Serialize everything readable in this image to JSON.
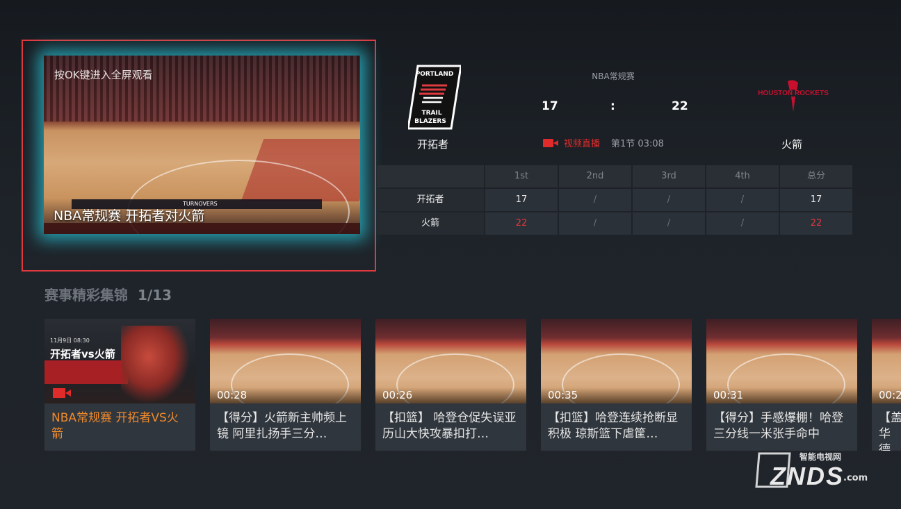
{
  "player": {
    "hint": "按OK键进入全屏观看",
    "title": "NBA常规赛 开拓者对火箭",
    "scorebug": "TURNOVERS"
  },
  "match": {
    "league": "NBA常规赛",
    "home": {
      "name": "开拓者",
      "score": "17",
      "logo": "portland-trail-blazers-logo"
    },
    "away": {
      "name": "火箭",
      "score": "22",
      "logo": "houston-rockets-logo"
    },
    "separator": ":",
    "live_label": "视频直播",
    "period": "第1节 03:08"
  },
  "score_table": {
    "headers": [
      "",
      "1st",
      "2nd",
      "3rd",
      "4th",
      "总分"
    ],
    "rows": [
      {
        "team": "开拓者",
        "q1": "17",
        "q2": "/",
        "q3": "/",
        "q4": "/",
        "total": "17"
      },
      {
        "team": "火箭",
        "q1": "22",
        "q2": "/",
        "q3": "/",
        "q4": "/",
        "total": "22"
      }
    ]
  },
  "highlights": {
    "title": "赛事精彩集锦",
    "count": "1/13",
    "items": [
      {
        "title": "NBA常规赛 开拓者VS火箭",
        "duration": "",
        "poster_text": "开拓者vs火箭",
        "poster_date": "11月9日 08:30"
      },
      {
        "title": "【得分】火箭新主帅频上镜 阿里扎扬手三分…",
        "duration": "00:28"
      },
      {
        "title": "【扣篮】 哈登仓促失误亚历山大快攻暴扣打…",
        "duration": "00:26"
      },
      {
        "title": "【扣篮】哈登连续抢断显积极 琼斯篮下虐筐…",
        "duration": "00:35"
      },
      {
        "title": "【得分】手感爆棚！哈登三分线一米张手命中",
        "duration": "00:31"
      },
      {
        "title": "【盖华德",
        "duration": "00:2"
      }
    ]
  },
  "watermark": {
    "top": "智能电视网",
    "main": "ZNDS",
    "suffix": ".com"
  },
  "colors": {
    "accent_red": "#e0393e",
    "focus_glow": "#28c8dc",
    "selected_title": "#f08a2c"
  }
}
